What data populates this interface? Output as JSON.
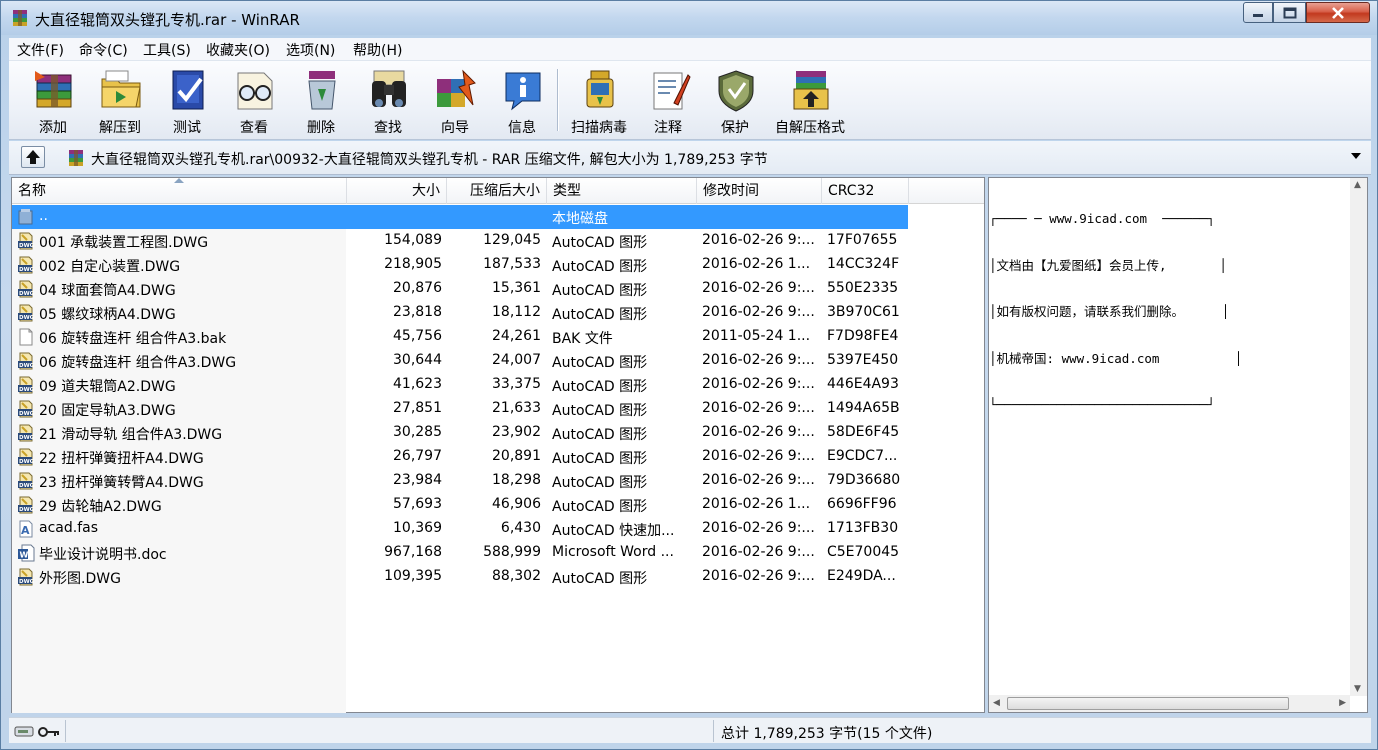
{
  "window": {
    "title": "大直径辊筒双头镗孔专机.rar - WinRAR"
  },
  "menu": [
    "文件(F)",
    "命令(C)",
    "工具(S)",
    "收藏夹(O)",
    "选项(N)",
    "帮助(H)"
  ],
  "toolbar": {
    "buttons": [
      {
        "label": "添加",
        "icon": "archive-add-icon"
      },
      {
        "label": "解压到",
        "icon": "extract-folder-icon"
      },
      {
        "label": "测试",
        "icon": "test-check-icon"
      },
      {
        "label": "查看",
        "icon": "view-glasses-icon"
      },
      {
        "label": "删除",
        "icon": "delete-recycle-icon"
      },
      {
        "label": "查找",
        "icon": "find-binoculars-icon"
      },
      {
        "label": "向导",
        "icon": "wizard-icon"
      },
      {
        "label": "信息",
        "icon": "info-icon"
      },
      {
        "label": "扫描病毒",
        "icon": "virus-scan-icon"
      },
      {
        "label": "注释",
        "icon": "comment-pen-icon"
      },
      {
        "label": "保护",
        "icon": "protect-shield-icon"
      },
      {
        "label": "自解压格式",
        "icon": "sfx-box-icon"
      }
    ]
  },
  "address": {
    "path": "大直径辊筒双头镗孔专机.rar\\00932-大直径辊筒双头镗孔专机 - RAR 压缩文件, 解包大小为 1,789,253 字节"
  },
  "columns": {
    "name": "名称",
    "size": "大小",
    "packed": "压缩后大小",
    "type": "类型",
    "mtime": "修改时间",
    "crc": "CRC32"
  },
  "files": [
    {
      "name": "..",
      "size": "",
      "packed": "",
      "type": "本地磁盘",
      "mtime": "",
      "crc": "",
      "icon": "parent-folder-icon",
      "selected": true
    },
    {
      "name": "001 承载装置工程图.DWG",
      "size": "154,089",
      "packed": "129,045",
      "type": "AutoCAD 图形",
      "mtime": "2016-02-26 9:...",
      "crc": "17F07655",
      "icon": "dwg-file-icon"
    },
    {
      "name": "002 自定心装置.DWG",
      "size": "218,905",
      "packed": "187,533",
      "type": "AutoCAD 图形",
      "mtime": "2016-02-26 1...",
      "crc": "14CC324F",
      "icon": "dwg-file-icon"
    },
    {
      "name": "04 球面套筒A4.DWG",
      "size": "20,876",
      "packed": "15,361",
      "type": "AutoCAD 图形",
      "mtime": "2016-02-26 9:...",
      "crc": "550E2335",
      "icon": "dwg-file-icon"
    },
    {
      "name": "05 螺纹球柄A4.DWG",
      "size": "23,818",
      "packed": "18,112",
      "type": "AutoCAD 图形",
      "mtime": "2016-02-26 9:...",
      "crc": "3B970C61",
      "icon": "dwg-file-icon"
    },
    {
      "name": "06 旋转盘连杆 组合件A3.bak",
      "size": "45,756",
      "packed": "24,261",
      "type": "BAK 文件",
      "mtime": "2011-05-24 1...",
      "crc": "F7D98FE4",
      "icon": "blank-file-icon"
    },
    {
      "name": "06 旋转盘连杆 组合件A3.DWG",
      "size": "30,644",
      "packed": "24,007",
      "type": "AutoCAD 图形",
      "mtime": "2016-02-26 9:...",
      "crc": "5397E450",
      "icon": "dwg-file-icon"
    },
    {
      "name": "09 道夫辊筒A2.DWG",
      "size": "41,623",
      "packed": "33,375",
      "type": "AutoCAD 图形",
      "mtime": "2016-02-26 9:...",
      "crc": "446E4A93",
      "icon": "dwg-file-icon"
    },
    {
      "name": "20 固定导轨A3.DWG",
      "size": "27,851",
      "packed": "21,633",
      "type": "AutoCAD 图形",
      "mtime": "2016-02-26 9:...",
      "crc": "1494A65B",
      "icon": "dwg-file-icon"
    },
    {
      "name": "21 滑动导轨 组合件A3.DWG",
      "size": "30,285",
      "packed": "23,902",
      "type": "AutoCAD 图形",
      "mtime": "2016-02-26 9:...",
      "crc": "58DE6F45",
      "icon": "dwg-file-icon"
    },
    {
      "name": "22 扭杆弹簧扭杆A4.DWG",
      "size": "26,797",
      "packed": "20,891",
      "type": "AutoCAD 图形",
      "mtime": "2016-02-26 9:...",
      "crc": "E9CDC7...",
      "icon": "dwg-file-icon"
    },
    {
      "name": "23 扭杆弹簧转臂A4.DWG",
      "size": "23,984",
      "packed": "18,298",
      "type": "AutoCAD 图形",
      "mtime": "2016-02-26 9:...",
      "crc": "79D36680",
      "icon": "dwg-file-icon"
    },
    {
      "name": "29 齿轮轴A2.DWG",
      "size": "57,693",
      "packed": "46,906",
      "type": "AutoCAD 图形",
      "mtime": "2016-02-26 1...",
      "crc": "6696FF96",
      "icon": "dwg-file-icon"
    },
    {
      "name": "acad.fas",
      "size": "10,369",
      "packed": "6,430",
      "type": "AutoCAD 快速加...",
      "mtime": "2016-02-26 9:...",
      "crc": "1713FB30",
      "icon": "fas-file-icon"
    },
    {
      "name": "毕业设计说明书.doc",
      "size": "967,168",
      "packed": "588,999",
      "type": "Microsoft Word ...",
      "mtime": "2016-02-26 9:...",
      "crc": "C5E70045",
      "icon": "word-doc-icon"
    },
    {
      "name": "外形图.DWG",
      "size": "109,395",
      "packed": "88,302",
      "type": "AutoCAD 图形",
      "mtime": "2016-02-26 9:...",
      "crc": "E249DA...",
      "icon": "dwg-file-icon"
    }
  ],
  "comment": {
    "lines": [
      "┌──── ─ www.9icad.com  ──────┐",
      "│文档由【九爱图纸】会员上传,       │",
      "│如有版权问题，请联系我们删除。     │",
      "│机械帝国: www.9icad.com          │",
      "└────────────────────────────┘"
    ]
  },
  "status": {
    "total": "总计 1,789,253 字节(15 个文件)"
  },
  "colors": {
    "selection": "#3399ff",
    "name_column_bg": "#f7f7f7",
    "close_button": "#c2391f"
  }
}
